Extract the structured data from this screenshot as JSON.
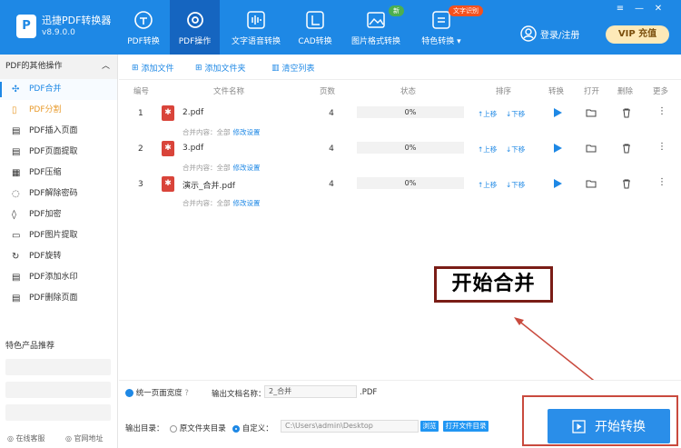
{
  "app": {
    "name": "迅捷PDF转换器",
    "version": "v8.9.0.0",
    "logo": "P"
  },
  "top_tabs": [
    {
      "label": "PDF转换",
      "icon": "refresh-doc-icon"
    },
    {
      "label": "PDF操作",
      "icon": "gear-doc-icon",
      "active": true
    },
    {
      "label": "文字语音转换",
      "icon": "audio-wave-icon"
    },
    {
      "label": "CAD转换",
      "icon": "cad-icon"
    },
    {
      "label": "图片格式转换",
      "icon": "image-icon",
      "badge": "新"
    },
    {
      "label": "特色转换",
      "icon": "special-convert-icon",
      "badge": "文字识别"
    }
  ],
  "login_label": "登录/注册",
  "vip_label": "VIP 充值",
  "sidebar": {
    "header": "PDF的其他操作",
    "items": [
      {
        "label": "PDF合并",
        "active": true
      },
      {
        "label": "PDF分割",
        "style": "orange"
      },
      {
        "label": "PDF插入页面"
      },
      {
        "label": "PDF页面提取"
      },
      {
        "label": "PDF压缩"
      },
      {
        "label": "PDF解除密码"
      },
      {
        "label": "PDF加密"
      },
      {
        "label": "PDF图片提取"
      },
      {
        "label": "PDF旋转"
      },
      {
        "label": "PDF添加水印"
      },
      {
        "label": "PDF删除页面"
      }
    ],
    "recommend_title": "特色产品推荐",
    "online_support": "在线客服",
    "official_site": "官网地址"
  },
  "toolbar": {
    "add_file": "添加文件",
    "add_folder": "添加文件夹",
    "clear_list": "清空列表"
  },
  "table": {
    "headers": [
      "编号",
      "文件名称",
      "页数",
      "状态",
      "排序",
      "转换",
      "打开",
      "删除",
      "更多"
    ],
    "rows": [
      {
        "no": "1",
        "name": "2.pdf",
        "pages": "4",
        "progress": "0%",
        "range_label": "合并内容：",
        "range_value": "全部",
        "modify": "修改设置"
      },
      {
        "no": "2",
        "name": "3.pdf",
        "pages": "4",
        "progress": "0%",
        "range_label": "合并内容：",
        "range_value": "全部",
        "modify": "修改设置"
      },
      {
        "no": "3",
        "name": "演示_合并.pdf",
        "pages": "4",
        "progress": "0%",
        "range_label": "合并内容：",
        "range_value": "全部",
        "modify": "修改设置"
      }
    ],
    "move_up": "上移",
    "move_down": "下移"
  },
  "bottom": {
    "unify_width": "统一页面宽度",
    "output_name_label": "输出文档名称：",
    "output_name_value": "2_合并",
    "ext": ".PDF",
    "output_dir_label": "输出目录：",
    "orig_dir": "原文件夹目录",
    "custom": "自定义：",
    "path": "C:\\Users\\admin\\Desktop",
    "browse": "浏览",
    "open_folder": "打开文件目录",
    "start": "开始转换"
  },
  "annotation_text": "开始合并",
  "colors": {
    "brand": "#1e88e5",
    "annotation_border": "#7a1d16",
    "highlight": "#c94a3e"
  }
}
